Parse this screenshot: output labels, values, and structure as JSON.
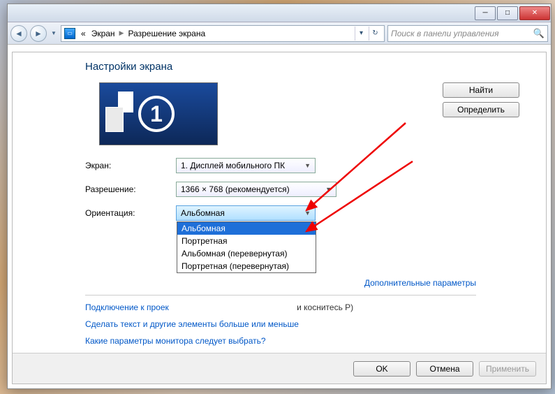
{
  "breadcrumb": {
    "prefix": "«",
    "item1": "Экран",
    "item2": "Разрешение экрана"
  },
  "search": {
    "placeholder": "Поиск в панели управления"
  },
  "heading": "Настройки экрана",
  "buttons": {
    "find": "Найти",
    "detect": "Определить"
  },
  "monitor_badge": "1",
  "rows": {
    "screen": {
      "label": "Экран:",
      "value": "1. Дисплей мобильного ПК"
    },
    "resolution": {
      "label": "Разрешение:",
      "value": "1366 × 768 (рекомендуется)"
    },
    "orientation": {
      "label": "Ориентация:",
      "value": "Альбомная"
    }
  },
  "orientation_options": [
    "Альбомная",
    "Портретная",
    "Альбомная (перевернутая)",
    "Портретная (перевернутая)"
  ],
  "links": {
    "advanced": "Дополнительные параметры",
    "projector": "Подключение к проек",
    "projector_tail": "и коснитесь P)",
    "textsize": "Сделать текст и другие элементы больше или меньше",
    "which_settings": "Какие параметры монитора следует выбрать?"
  },
  "footer": {
    "ok": "OK",
    "cancel": "Отмена",
    "apply": "Применить"
  }
}
